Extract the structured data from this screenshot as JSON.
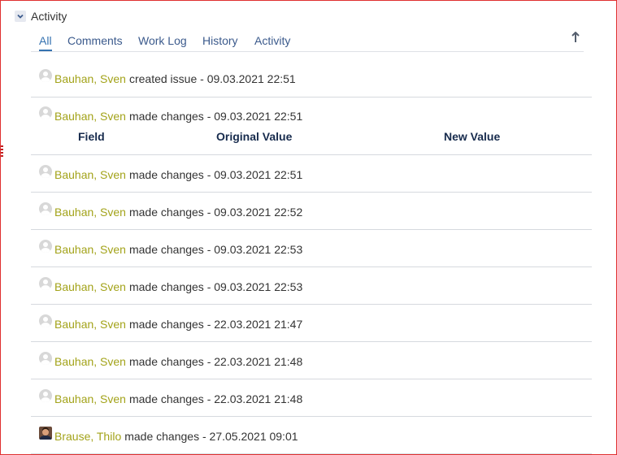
{
  "module": {
    "title": "Activity"
  },
  "tabs": [
    {
      "label": "All",
      "active": true
    },
    {
      "label": "Comments",
      "active": false
    },
    {
      "label": "Work Log",
      "active": false
    },
    {
      "label": "History",
      "active": false
    },
    {
      "label": "Activity",
      "active": false
    }
  ],
  "changes_table": {
    "headers": [
      "Field",
      "Original Value",
      "New Value"
    ]
  },
  "entries": [
    {
      "user": "Bauhan, Sven",
      "action": "created issue",
      "date": "09.03.2021 22:51",
      "avatar": "default-avatar"
    },
    {
      "user": "Bauhan, Sven",
      "action": "made changes",
      "date": "09.03.2021 22:51",
      "avatar": "default-avatar"
    },
    {
      "user": "Bauhan, Sven",
      "action": "made changes",
      "date": "09.03.2021 22:51",
      "avatar": "default-avatar"
    },
    {
      "user": "Bauhan, Sven",
      "action": "made changes",
      "date": "09.03.2021 22:52",
      "avatar": "default-avatar"
    },
    {
      "user": "Bauhan, Sven",
      "action": "made changes",
      "date": "09.03.2021 22:53",
      "avatar": "default-avatar"
    },
    {
      "user": "Bauhan, Sven",
      "action": "made changes",
      "date": "09.03.2021 22:53",
      "avatar": "default-avatar"
    },
    {
      "user": "Bauhan, Sven",
      "action": "made changes",
      "date": "22.03.2021 21:47",
      "avatar": "default-avatar"
    },
    {
      "user": "Bauhan, Sven",
      "action": "made changes",
      "date": "22.03.2021 21:48",
      "avatar": "default-avatar"
    },
    {
      "user": "Bauhan, Sven",
      "action": "made changes",
      "date": "22.03.2021 21:48",
      "avatar": "default-avatar"
    },
    {
      "user": "Brause, Thilo",
      "action": "made changes",
      "date": "27.05.2021 09:01",
      "avatar": "photo-avatar"
    }
  ],
  "colors": {
    "user_link": "#a3a31a",
    "tab_link": "#3b5a8c",
    "active_tab": "#3572b0",
    "frame_border": "#e03030"
  },
  "icons": {
    "toggle": "chevron-down-icon",
    "sort": "arrow-up-icon"
  }
}
